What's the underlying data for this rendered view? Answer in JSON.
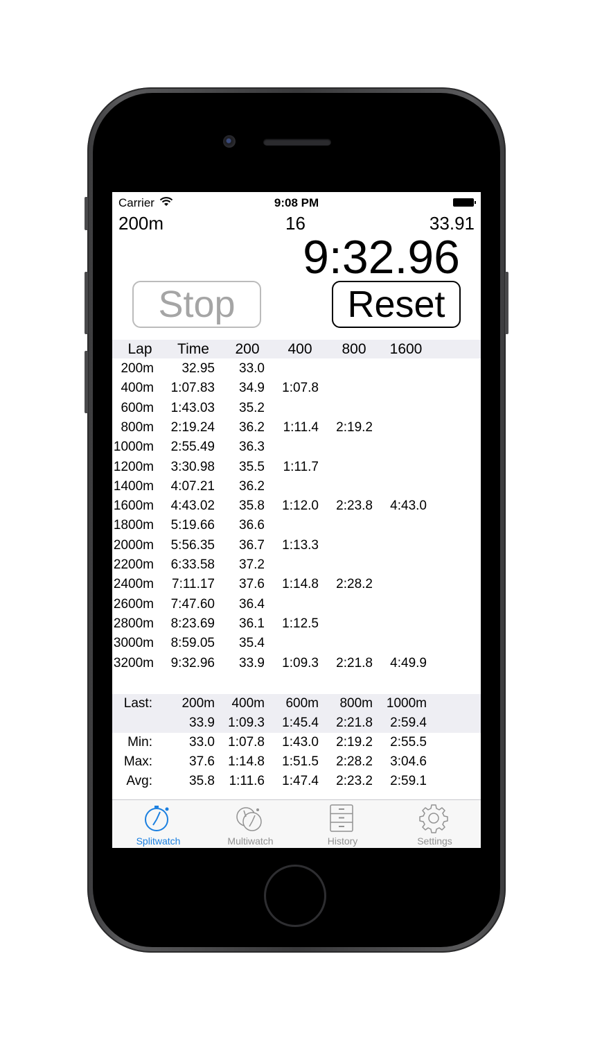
{
  "status_bar": {
    "carrier": "Carrier",
    "time": "9:08 PM"
  },
  "header": {
    "distance": "200m",
    "lap_count": "16",
    "last_lap_time": "33.91",
    "elapsed": "9:32.96"
  },
  "buttons": {
    "stop": "Stop",
    "reset": "Reset"
  },
  "splits_table": {
    "columns": [
      "Lap",
      "Time",
      "200",
      "400",
      "800",
      "1600"
    ],
    "rows": [
      [
        "200m",
        "32.95",
        "33.0",
        "",
        "",
        ""
      ],
      [
        "400m",
        "1:07.83",
        "34.9",
        "1:07.8",
        "",
        ""
      ],
      [
        "600m",
        "1:43.03",
        "35.2",
        "",
        "",
        ""
      ],
      [
        "800m",
        "2:19.24",
        "36.2",
        "1:11.4",
        "2:19.2",
        ""
      ],
      [
        "1000m",
        "2:55.49",
        "36.3",
        "",
        "",
        ""
      ],
      [
        "1200m",
        "3:30.98",
        "35.5",
        "1:11.7",
        "",
        ""
      ],
      [
        "1400m",
        "4:07.21",
        "36.2",
        "",
        "",
        ""
      ],
      [
        "1600m",
        "4:43.02",
        "35.8",
        "1:12.0",
        "2:23.8",
        "4:43.0"
      ],
      [
        "1800m",
        "5:19.66",
        "36.6",
        "",
        "",
        ""
      ],
      [
        "2000m",
        "5:56.35",
        "36.7",
        "1:13.3",
        "",
        ""
      ],
      [
        "2200m",
        "6:33.58",
        "37.2",
        "",
        "",
        ""
      ],
      [
        "2400m",
        "7:11.17",
        "37.6",
        "1:14.8",
        "2:28.2",
        ""
      ],
      [
        "2600m",
        "7:47.60",
        "36.4",
        "",
        "",
        ""
      ],
      [
        "2800m",
        "8:23.69",
        "36.1",
        "1:12.5",
        "",
        ""
      ],
      [
        "3000m",
        "8:59.05",
        "35.4",
        "",
        "",
        ""
      ],
      [
        "3200m",
        "9:32.96",
        "33.9",
        "1:09.3",
        "2:21.8",
        "4:49.9"
      ]
    ]
  },
  "summary": {
    "last_label": "Last:",
    "last_distances": [
      "200m",
      "400m",
      "600m",
      "800m",
      "1000m"
    ],
    "last_values": [
      "33.9",
      "1:09.3",
      "1:45.4",
      "2:21.8",
      "2:59.4"
    ],
    "stats": [
      {
        "label": "Min:",
        "values": [
          "33.0",
          "1:07.8",
          "1:43.0",
          "2:19.2",
          "2:55.5"
        ]
      },
      {
        "label": "Max:",
        "values": [
          "37.6",
          "1:14.8",
          "1:51.5",
          "2:28.2",
          "3:04.6"
        ]
      },
      {
        "label": "Avg:",
        "values": [
          "35.8",
          "1:11.6",
          "1:47.4",
          "2:23.2",
          "2:59.1"
        ]
      }
    ]
  },
  "tabs": [
    {
      "label": "Splitwatch",
      "icon": "stopwatch-icon",
      "active": true
    },
    {
      "label": "Multiwatch",
      "icon": "multi-stopwatch-icon",
      "active": false
    },
    {
      "label": "History",
      "icon": "file-cabinet-icon",
      "active": false
    },
    {
      "label": "Settings",
      "icon": "gear-icon",
      "active": false
    }
  ],
  "colors": {
    "accent": "#1a7fe0",
    "inactive_tab": "#929292",
    "header_bg": "#eeeef3"
  }
}
